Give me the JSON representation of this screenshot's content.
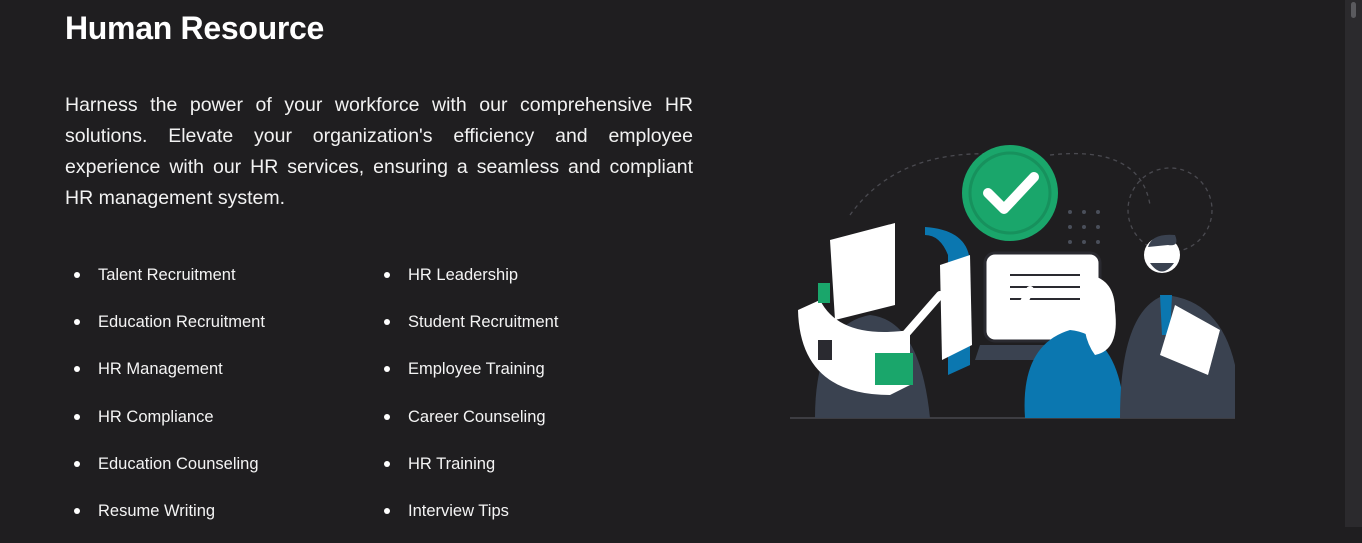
{
  "section": {
    "title": "Human Resource",
    "description": "Harness the power of your workforce with our comprehensive HR solutions. Elevate your organization's efficiency and employee experience with our HR services, ensuring a seamless and compliant HR management system."
  },
  "services": {
    "column1": [
      "Talent Recruitment",
      "Education Recruitment",
      "HR Management",
      "HR Compliance",
      "Education Counseling",
      "Resume Writing"
    ],
    "column2": [
      "HR Leadership",
      "Student Recruitment",
      "Employee Training",
      "Career Counseling",
      "HR Training",
      "Interview Tips"
    ]
  },
  "colors": {
    "background": "#1f1e20",
    "accent_green": "#1aa66b",
    "accent_blue": "#0b77b0",
    "figure_dark": "#3a4250"
  }
}
